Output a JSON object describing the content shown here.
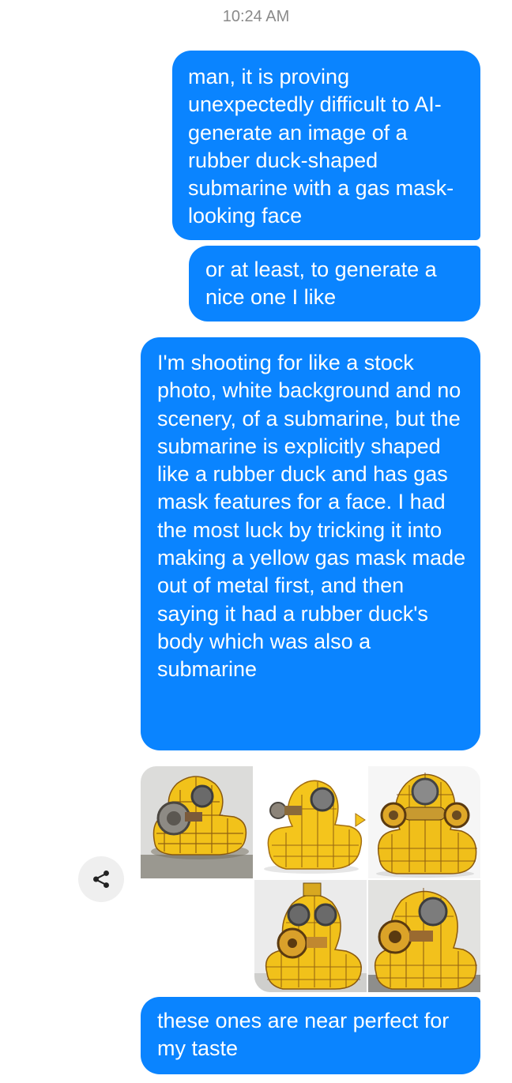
{
  "conversation": {
    "timestamp": "10:24 AM",
    "messages": [
      {
        "text": "man, it is proving unexpectedly difficult to AI-generate an image of a rubber duck-shaped submarine with a gas mask-looking face"
      },
      {
        "text": "or at least, to generate a nice one I like"
      },
      {
        "text": "I'm shooting for like a stock photo, white background and no scenery, of a submarine, but the submarine is explicitly shaped like a rubber duck and has gas mask features for a face. I had the most luck by tricking it into making a yellow gas mask made out of metal first, and then saying it had a rubber duck's body which was also a submarine"
      },
      {
        "text": "these ones are near perfect for my taste"
      }
    ],
    "attachments": {
      "count": 5,
      "subject": "yellow metal rubber duck submarine with gas mask face",
      "share_icon": "share-icon"
    }
  },
  "colors": {
    "bubble": "#0a84ff",
    "bubble_text": "#ffffff",
    "timestamp": "#8a8a8a",
    "share_button_bg": "#efefef",
    "duck_yellow": "#f2c21a"
  }
}
